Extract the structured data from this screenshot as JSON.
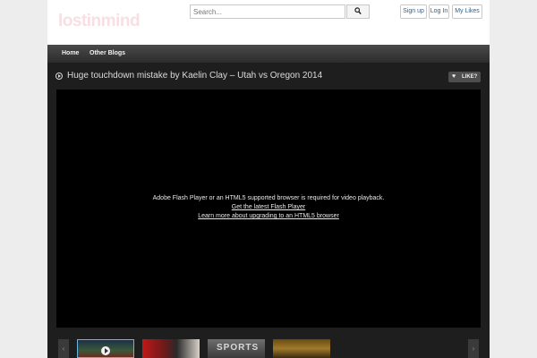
{
  "header": {
    "logo": "lostinmind",
    "search": {
      "placeholder": "Search..."
    },
    "buttons": {
      "signup": "Sign up",
      "login": "Log In",
      "mylikes": "My Likes"
    }
  },
  "nav": {
    "items": [
      {
        "label": "Home"
      },
      {
        "label": "Other Blogs"
      }
    ]
  },
  "post": {
    "title": "Huge touchdown mistake by Kaelin Clay – Utah vs Oregon 2014",
    "like_label": "LIKE?"
  },
  "video": {
    "message": "Adobe Flash Player or an HTML5 supported browser is required for video playback.",
    "link1": "Get the latest Flash Player",
    "link2": "Learn more about upgrading to an HTML5 browser"
  },
  "thumbnails": {
    "thumb3_text": "SPORTS"
  },
  "colors": {
    "nav_bg": "#2c2c2c",
    "main_bg": "#1e1e1e",
    "link_blue": "#2a6496",
    "thumb_active_border": "#6bb5e0"
  },
  "icons": [
    "search-icon",
    "play-circle-icon",
    "heart-icon",
    "arrow-left-icon",
    "arrow-right-icon",
    "play-icon"
  ]
}
